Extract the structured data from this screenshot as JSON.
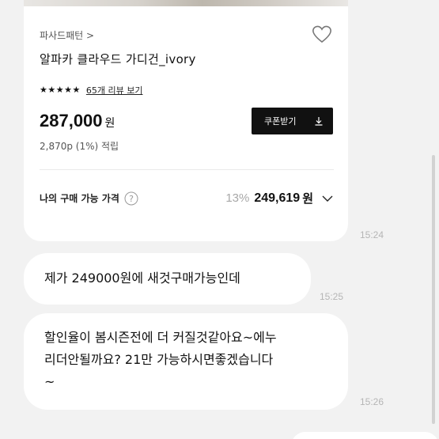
{
  "product_card": {
    "brand": "파사드패턴 >",
    "title": "알파카 클라우드 가디건_ivory",
    "rating_stars": 5,
    "review_link": "65개 리뷰 보기",
    "price": "287,000",
    "currency": "원",
    "points": "2,870p (1%) 적립",
    "coupon_button": "쿠폰받기",
    "my_price_label": "나의 구매 가능 가격",
    "discount_rate": "13%",
    "final_price": "249,619",
    "final_currency": "원"
  },
  "messages": [
    {
      "text": "제가 249000원에 새것구매가능인데",
      "time": "15:25"
    },
    {
      "text": "할인율이 봄시즌전에 더 커질것같아요~에누\n리더안될까요? 21만 가능하시면좋겠습니다\n~",
      "time": "15:26"
    }
  ],
  "card_time": "15:24",
  "icons": [
    "heart-icon",
    "star-icon",
    "download-icon",
    "question-circle-icon",
    "chevron-down-icon"
  ],
  "colors": {
    "background": "#f2f2f2",
    "bubble": "#ffffff",
    "button": "#111111",
    "discount": "#a8a8a8",
    "time": "#b5b5b5"
  }
}
